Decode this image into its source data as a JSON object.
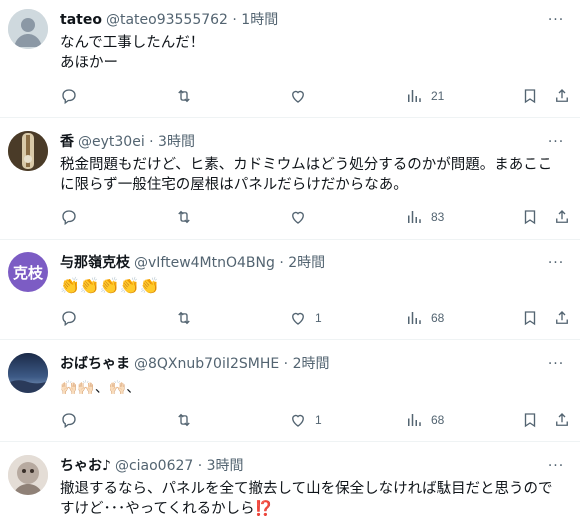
{
  "tweets": [
    {
      "name": "tateo",
      "handle": "@tateo93555762 · 1時間",
      "lines": "なんで工事したんだ！\nあほかー",
      "views": "21",
      "likes": ""
    },
    {
      "name": "香",
      "handle": "@eyt30ei · 3時間",
      "lines": "税金問題もだけど、ヒ素、カドミウムはどう処分するのかが問題。まあここ\nに限らず一般住宅の屋根はパネルだらけだからなあ。",
      "views": "83",
      "likes": ""
    },
    {
      "name": "与那嶺克枝",
      "handle": "@vIftew4MtnO4BNg · 2時間",
      "lines": "👏👏👏👏👏",
      "views": "68",
      "likes": "1",
      "avatar_text": "克枝"
    },
    {
      "name": "おばちゃま",
      "handle": "@8QXnub70iI2SMHE · 2時間",
      "lines": "🙌🏻🙌🏻、🙌🏻、",
      "views": "68",
      "likes": "1"
    },
    {
      "name": "ちゃお♪",
      "handle": "@ciao0627 · 3時間",
      "lines": "撤退するなら、パネルを全て撤去して山を保全しなければ駄目だと思うので\nすけど･･･やってくれるかしら⁉️",
      "views": "",
      "likes": ""
    }
  ],
  "colors": {
    "icon": "#536471",
    "text": "#0f1419",
    "divider": "#eff3f4",
    "avatar_purple": "#7c5cc4"
  },
  "icons": [
    "reply-icon",
    "retweet-icon",
    "like-icon",
    "views-icon",
    "bookmark-icon",
    "share-icon",
    "more-icon"
  ]
}
